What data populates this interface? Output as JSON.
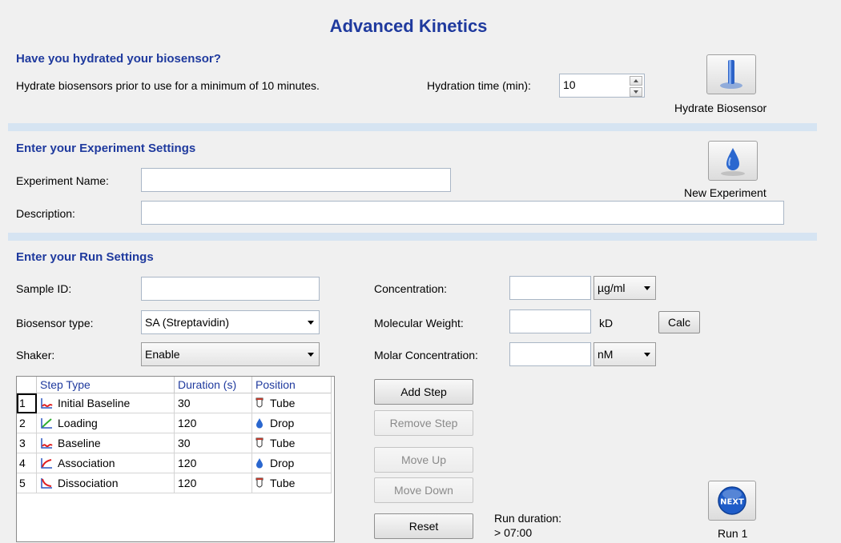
{
  "title": "Advanced Kinetics",
  "hydration": {
    "heading": "Have you hydrated your biosensor?",
    "note": "Hydrate biosensors prior to use for a minimum of 10 minutes.",
    "time_label": "Hydration time (min):",
    "time_value": "10",
    "button_label": "Hydrate Biosensor"
  },
  "experiment": {
    "heading": "Enter your Experiment Settings",
    "name_label": "Experiment Name:",
    "name_value": "",
    "description_label": "Description:",
    "description_value": "",
    "button_label": "New Experiment"
  },
  "run": {
    "heading": "Enter your Run Settings",
    "sample_id_label": "Sample ID:",
    "sample_id_value": "",
    "biosensor_label": "Biosensor type:",
    "biosensor_value": "SA (Streptavidin)",
    "shaker_label": "Shaker:",
    "shaker_value": "Enable",
    "concentration_label": "Concentration:",
    "concentration_value": "",
    "concentration_unit": "µg/ml",
    "mw_label": "Molecular Weight:",
    "mw_value": "",
    "mw_unit": "kD",
    "calc_label": "Calc",
    "molar_label": "Molar Concentration:",
    "molar_value": "",
    "molar_unit": "nM"
  },
  "steps": {
    "headers": [
      "Step Type",
      "Duration (s)",
      "Position"
    ],
    "rows": [
      {
        "num": "1",
        "type": "Initial Baseline",
        "icon": "baseline-icon",
        "duration": "30",
        "position": "Tube",
        "pos_icon": "tube-icon"
      },
      {
        "num": "2",
        "type": "Loading",
        "icon": "loading-icon",
        "duration": "120",
        "position": "Drop",
        "pos_icon": "drop-icon"
      },
      {
        "num": "3",
        "type": "Baseline",
        "icon": "baseline-icon",
        "duration": "30",
        "position": "Tube",
        "pos_icon": "tube-icon"
      },
      {
        "num": "4",
        "type": "Association",
        "icon": "association-icon",
        "duration": "120",
        "position": "Drop",
        "pos_icon": "drop-icon"
      },
      {
        "num": "5",
        "type": "Dissociation",
        "icon": "dissociation-icon",
        "duration": "120",
        "position": "Tube",
        "pos_icon": "tube-icon"
      }
    ]
  },
  "actions": {
    "add_step": "Add Step",
    "remove_step": "Remove Step",
    "move_up": "Move Up",
    "move_down": "Move Down",
    "reset": "Reset"
  },
  "run_duration": {
    "label": "Run duration:",
    "value": "> 07:00"
  },
  "next_button": {
    "icon_text": "NEXT",
    "label": "Run 1"
  },
  "colors": {
    "heading": "#1f3a9e",
    "separator": "#d6e4f2",
    "next_button": "#1e5cc8"
  }
}
